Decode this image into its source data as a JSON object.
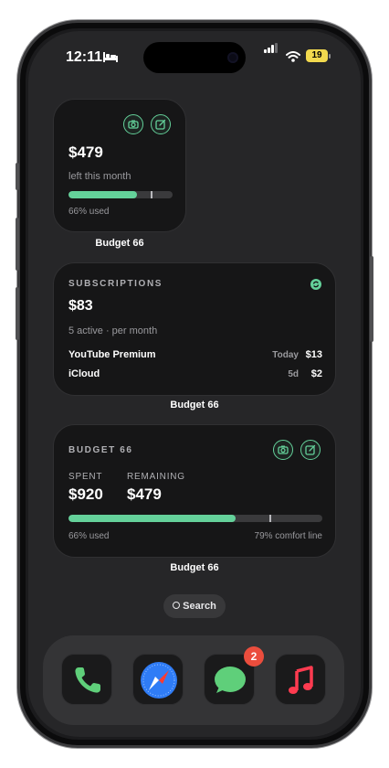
{
  "status_bar": {
    "time": "12:11",
    "battery_percent": "19",
    "icons": [
      "bed-icon",
      "signal-icon",
      "wifi-icon",
      "battery-icon"
    ]
  },
  "widgets": {
    "small": {
      "amount": "$479",
      "subtitle": "left this month",
      "used_fraction": 0.66,
      "comfort_fraction": 0.79,
      "used_label": "66% used",
      "label": "Budget 66",
      "icons": [
        "camera-icon",
        "edit-icon"
      ]
    },
    "subscriptions": {
      "title": "SUBSCRIPTIONS",
      "amount": "$83",
      "subtitle": "5 active · per month",
      "rows": [
        {
          "name": "YouTube Premium",
          "when": "Today",
          "amount": "$13"
        },
        {
          "name": "iCloud",
          "when": "5d",
          "amount": "$2"
        }
      ],
      "label": "Budget 66",
      "icons": [
        "refresh-icon"
      ]
    },
    "large": {
      "title": "BUDGET 66",
      "spent_label": "SPENT",
      "spent_value": "$920",
      "remaining_label": "REMAINING",
      "remaining_value": "$479",
      "used_fraction": 0.66,
      "comfort_fraction": 0.79,
      "used_label": "66% used",
      "comfort_label": "79% comfort line",
      "label": "Budget 66",
      "icons": [
        "camera-icon",
        "edit-icon"
      ]
    }
  },
  "search": {
    "label": "Search",
    "icon": "search-icon"
  },
  "dock": {
    "apps": [
      {
        "name": "Phone",
        "icon": "phone-icon"
      },
      {
        "name": "Safari",
        "icon": "safari-icon"
      },
      {
        "name": "Messages",
        "icon": "messages-icon",
        "badge": "2"
      },
      {
        "name": "Music",
        "icon": "music-icon"
      }
    ]
  },
  "colors": {
    "accent": "#64d19a",
    "widget_bg": "#161617",
    "screen_bg": "#262628",
    "badge": "#eb4d3d",
    "battery": "#f2d94e"
  }
}
